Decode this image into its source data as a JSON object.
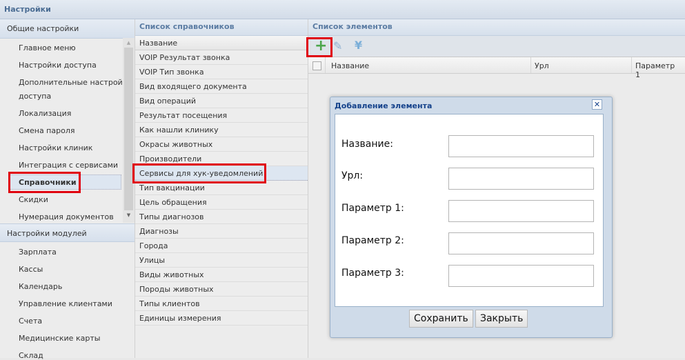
{
  "title": "Настройки",
  "left": {
    "general_header": "Общие настройки",
    "general_items": [
      "Главное меню",
      "Настройки доступа",
      "Дополнительные настройки",
      "доступа",
      "Локализация",
      "Смена пароля",
      "Настройки клиник",
      "Интеграция с сервисами",
      "Справочники",
      "Скидки",
      "Нумерация документов"
    ],
    "modules_header": "Настройки модулей",
    "module_items": [
      "Зарплата",
      "Кассы",
      "Календарь",
      "Управление клиентами",
      "Счета",
      "Медицинские карты",
      "Склад"
    ]
  },
  "middle": {
    "header": "Список справочников",
    "column": "Название",
    "rows": [
      "VOIP Результат звонка",
      "VOIP Тип звонка",
      "Вид входящего документа",
      "Вид операций",
      "Результат посещения",
      "Как нашли клинику",
      "Окрасы животных",
      "Производители",
      "Сервисы для хук-уведомлений",
      "Тип вакцинации",
      "Цель обращения",
      "Типы диагнозов",
      "Диагнозы",
      "Города",
      "Улицы",
      "Виды животных",
      "Породы животных",
      "Типы клиентов",
      "Единицы измерения"
    ]
  },
  "right": {
    "header": "Список элементов",
    "columns": [
      "Название",
      "Урл",
      "Параметр 1"
    ]
  },
  "dialog": {
    "title": "Добавление элемента",
    "fields": [
      {
        "label": "Название:",
        "value": ""
      },
      {
        "label": "Урл:",
        "value": ""
      },
      {
        "label": "Параметр 1:",
        "value": ""
      },
      {
        "label": "Параметр 2:",
        "value": ""
      },
      {
        "label": "Параметр 3:",
        "value": ""
      }
    ],
    "save": "Сохранить",
    "close": "Закрыть"
  }
}
